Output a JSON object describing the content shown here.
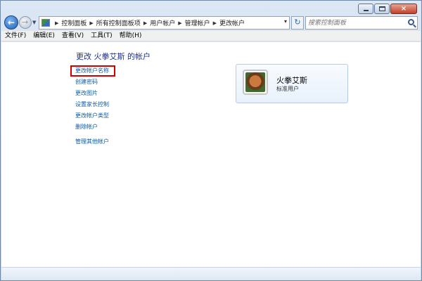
{
  "caption": {
    "close_glyph": "×"
  },
  "nav": {
    "breadcrumbs": [
      "控制面板",
      "所有控制面板项",
      "用户帐户",
      "管理帐户",
      "更改帐户"
    ],
    "search_placeholder": "搜索控制面板"
  },
  "menu": [
    "文件(F)",
    "编辑(E)",
    "查看(V)",
    "工具(T)",
    "帮助(H)"
  ],
  "main": {
    "title": "更改 火拳艾斯 的帐户",
    "links": [
      "更改帐户名称",
      "创建密码",
      "更改图片",
      "设置家长控制",
      "更改帐户类型",
      "删除帐户",
      "管理其他帐户"
    ],
    "highlighted_link": "更改帐户名称",
    "highlight_color": "#d40000"
  },
  "account": {
    "name": "火拳艾斯",
    "role": "标准用户",
    "avatar_icon": "dog-picture-icon"
  },
  "colors": {
    "link": "#0e5ca8",
    "title": "#1e3287"
  }
}
